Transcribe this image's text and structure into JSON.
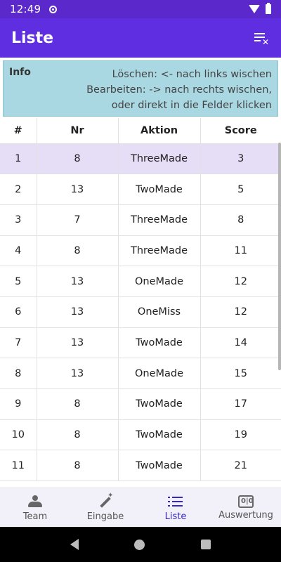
{
  "status": {
    "time": "12:49"
  },
  "appbar": {
    "title": "Liste",
    "action_icon": "clear-list-icon"
  },
  "info": {
    "label": "Info",
    "line1": "Löschen: <- nach links wischen",
    "line2": "Bearbeiten: -> nach rechts wischen,",
    "line3": "oder direkt in die Felder klicken"
  },
  "table": {
    "headers": [
      "#",
      "Nr",
      "Aktion",
      "Score"
    ],
    "rows": [
      {
        "idx": "1",
        "nr": "8",
        "action": "ThreeMade",
        "score": "3"
      },
      {
        "idx": "2",
        "nr": "13",
        "action": "TwoMade",
        "score": "5"
      },
      {
        "idx": "3",
        "nr": "7",
        "action": "ThreeMade",
        "score": "8"
      },
      {
        "idx": "4",
        "nr": "8",
        "action": "ThreeMade",
        "score": "11"
      },
      {
        "idx": "5",
        "nr": "13",
        "action": "OneMade",
        "score": "12"
      },
      {
        "idx": "6",
        "nr": "13",
        "action": "OneMiss",
        "score": "12"
      },
      {
        "idx": "7",
        "nr": "13",
        "action": "TwoMade",
        "score": "14"
      },
      {
        "idx": "8",
        "nr": "13",
        "action": "OneMade",
        "score": "15"
      },
      {
        "idx": "9",
        "nr": "8",
        "action": "TwoMade",
        "score": "17"
      },
      {
        "idx": "10",
        "nr": "8",
        "action": "TwoMade",
        "score": "19"
      },
      {
        "idx": "11",
        "nr": "8",
        "action": "TwoMade",
        "score": "21"
      }
    ]
  },
  "nav": {
    "items": [
      {
        "label": "Team",
        "icon": "team-icon"
      },
      {
        "label": "Eingabe",
        "icon": "pen-icon"
      },
      {
        "label": "Liste",
        "icon": "list-icon"
      },
      {
        "label": "Auswertung",
        "icon": "scoreboard-icon"
      }
    ]
  },
  "colors": {
    "appbar": "#5f2ee0",
    "info_bg": "#a9d8e3",
    "selected_row": "#e6ddf7",
    "nav_active": "#3527c9"
  }
}
